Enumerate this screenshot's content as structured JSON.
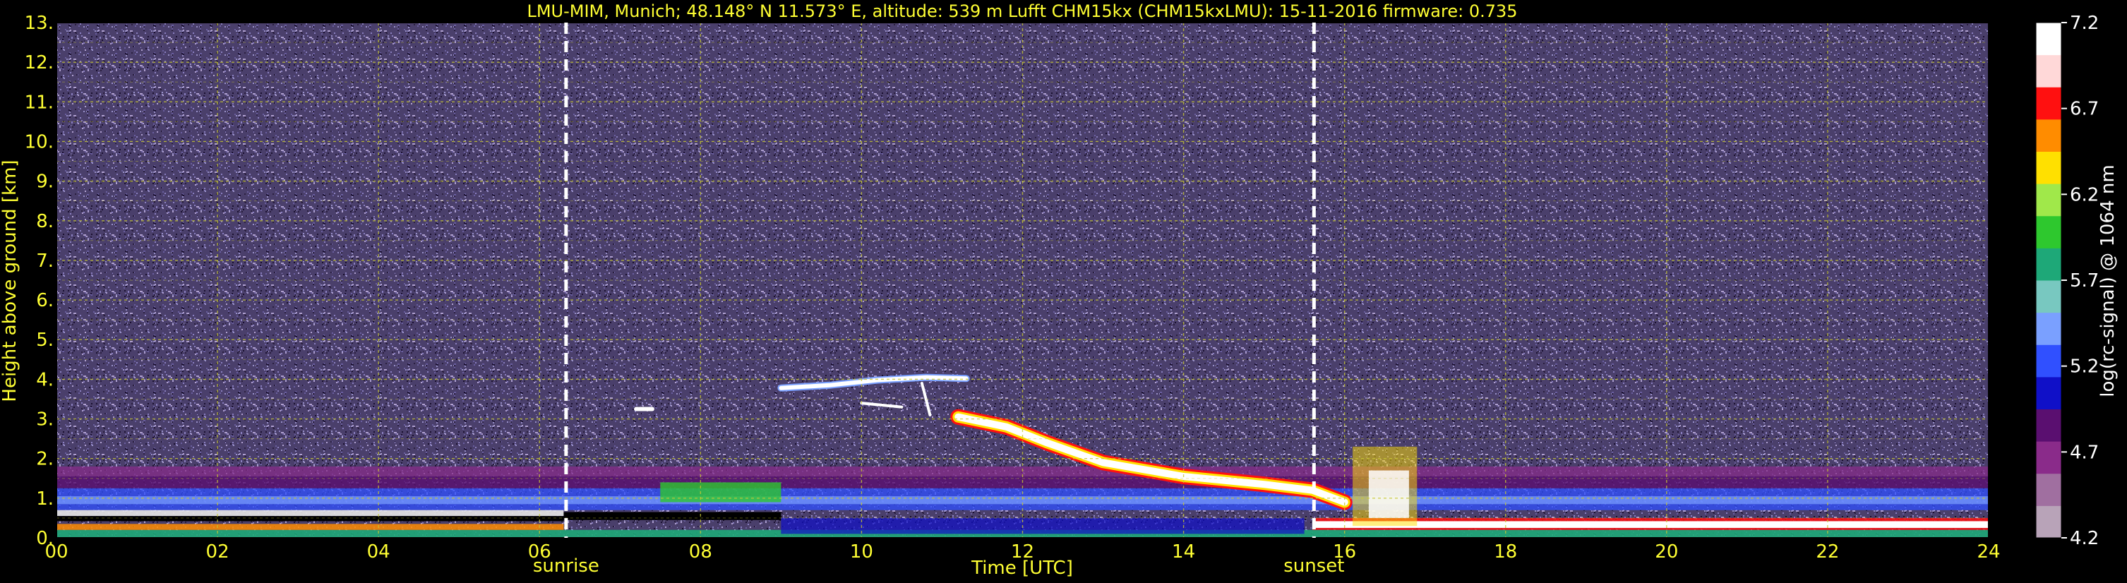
{
  "chart_data": {
    "type": "heatmap",
    "title": "LMU-MIM, Munich; 48.148° N 11.573° E, altitude: 539 m     Lufft CHM15kx (CHM15kxLMU): 15-11-2016     firmware: 0.735",
    "xlabel": "Time [UTC]",
    "ylabel": "Height above ground [km]",
    "xlim": [
      0,
      24
    ],
    "ylim": [
      0,
      13
    ],
    "x_ticks": [
      "00",
      "02",
      "04",
      "06",
      "08",
      "10",
      "12",
      "14",
      "16",
      "18",
      "20",
      "22",
      "24"
    ],
    "y_ticks": [
      "0.",
      "1.",
      "2.",
      "3.",
      "4.",
      "5.",
      "6.",
      "7.",
      "8.",
      "9.",
      "10.",
      "11.",
      "12.",
      "13."
    ],
    "grid": true,
    "markers": [
      {
        "label": "sunrise",
        "x": 6.33
      },
      {
        "label": "sunset",
        "x": 15.62
      }
    ],
    "colorbar": {
      "label": "log(rc-signal) @ 1064 nm",
      "range": [
        4.2,
        7.2
      ],
      "ticks": [
        "4.2",
        "4.7",
        "5.2",
        "5.7",
        "6.2",
        "6.7",
        "7.2"
      ]
    },
    "features": [
      {
        "name": "boundary layer aerosol",
        "x": [
          0,
          24
        ],
        "y": [
          0,
          1.8
        ]
      },
      {
        "name": "cloud layer",
        "x": [
          9.0,
          11.3
        ],
        "y": [
          3.7,
          4.1
        ]
      },
      {
        "name": "descending cloud",
        "x": [
          11.2,
          16.0
        ],
        "y": [
          1.3,
          3.1
        ]
      },
      {
        "name": "low cloud",
        "x": [
          15.6,
          24
        ],
        "y": [
          0.2,
          0.6
        ]
      }
    ]
  },
  "colors": {
    "background": "#000000",
    "text_title": "#ffff33",
    "text_colorbar": "#ffffff",
    "noise": "#4a3f6b",
    "grid": "#c8c832",
    "colormap": [
      "#b8a3b8",
      "#a06fa0",
      "#8a2b8a",
      "#5a0f70",
      "#1010c8",
      "#3050ff",
      "#7aa0ff",
      "#78c8c0",
      "#1ea878",
      "#2ec82e",
      "#a0e84a",
      "#ffe000",
      "#ff8c00",
      "#ff1010",
      "#ffd8d8",
      "#ffffff"
    ]
  }
}
